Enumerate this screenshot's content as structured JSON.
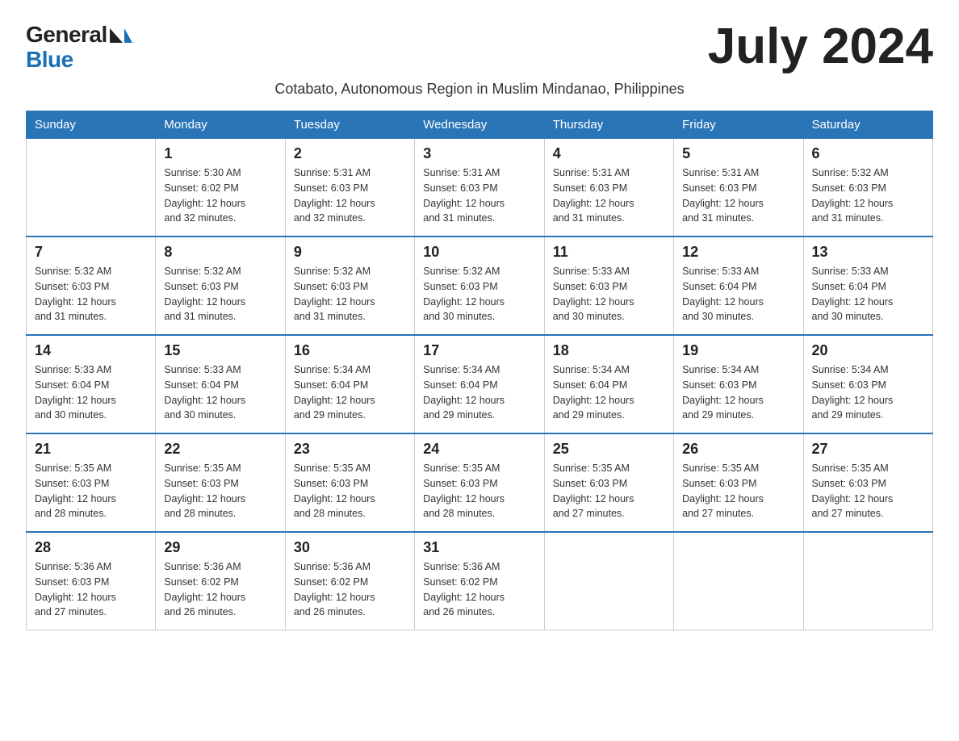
{
  "logo": {
    "general": "General",
    "blue": "Blue"
  },
  "title": "July 2024",
  "subtitle": "Cotabato, Autonomous Region in Muslim Mindanao, Philippines",
  "weekdays": [
    "Sunday",
    "Monday",
    "Tuesday",
    "Wednesday",
    "Thursday",
    "Friday",
    "Saturday"
  ],
  "weeks": [
    [
      {
        "day": "",
        "detail": ""
      },
      {
        "day": "1",
        "detail": "Sunrise: 5:30 AM\nSunset: 6:02 PM\nDaylight: 12 hours\nand 32 minutes."
      },
      {
        "day": "2",
        "detail": "Sunrise: 5:31 AM\nSunset: 6:03 PM\nDaylight: 12 hours\nand 32 minutes."
      },
      {
        "day": "3",
        "detail": "Sunrise: 5:31 AM\nSunset: 6:03 PM\nDaylight: 12 hours\nand 31 minutes."
      },
      {
        "day": "4",
        "detail": "Sunrise: 5:31 AM\nSunset: 6:03 PM\nDaylight: 12 hours\nand 31 minutes."
      },
      {
        "day": "5",
        "detail": "Sunrise: 5:31 AM\nSunset: 6:03 PM\nDaylight: 12 hours\nand 31 minutes."
      },
      {
        "day": "6",
        "detail": "Sunrise: 5:32 AM\nSunset: 6:03 PM\nDaylight: 12 hours\nand 31 minutes."
      }
    ],
    [
      {
        "day": "7",
        "detail": "Sunrise: 5:32 AM\nSunset: 6:03 PM\nDaylight: 12 hours\nand 31 minutes."
      },
      {
        "day": "8",
        "detail": "Sunrise: 5:32 AM\nSunset: 6:03 PM\nDaylight: 12 hours\nand 31 minutes."
      },
      {
        "day": "9",
        "detail": "Sunrise: 5:32 AM\nSunset: 6:03 PM\nDaylight: 12 hours\nand 31 minutes."
      },
      {
        "day": "10",
        "detail": "Sunrise: 5:32 AM\nSunset: 6:03 PM\nDaylight: 12 hours\nand 30 minutes."
      },
      {
        "day": "11",
        "detail": "Sunrise: 5:33 AM\nSunset: 6:03 PM\nDaylight: 12 hours\nand 30 minutes."
      },
      {
        "day": "12",
        "detail": "Sunrise: 5:33 AM\nSunset: 6:04 PM\nDaylight: 12 hours\nand 30 minutes."
      },
      {
        "day": "13",
        "detail": "Sunrise: 5:33 AM\nSunset: 6:04 PM\nDaylight: 12 hours\nand 30 minutes."
      }
    ],
    [
      {
        "day": "14",
        "detail": "Sunrise: 5:33 AM\nSunset: 6:04 PM\nDaylight: 12 hours\nand 30 minutes."
      },
      {
        "day": "15",
        "detail": "Sunrise: 5:33 AM\nSunset: 6:04 PM\nDaylight: 12 hours\nand 30 minutes."
      },
      {
        "day": "16",
        "detail": "Sunrise: 5:34 AM\nSunset: 6:04 PM\nDaylight: 12 hours\nand 29 minutes."
      },
      {
        "day": "17",
        "detail": "Sunrise: 5:34 AM\nSunset: 6:04 PM\nDaylight: 12 hours\nand 29 minutes."
      },
      {
        "day": "18",
        "detail": "Sunrise: 5:34 AM\nSunset: 6:04 PM\nDaylight: 12 hours\nand 29 minutes."
      },
      {
        "day": "19",
        "detail": "Sunrise: 5:34 AM\nSunset: 6:03 PM\nDaylight: 12 hours\nand 29 minutes."
      },
      {
        "day": "20",
        "detail": "Sunrise: 5:34 AM\nSunset: 6:03 PM\nDaylight: 12 hours\nand 29 minutes."
      }
    ],
    [
      {
        "day": "21",
        "detail": "Sunrise: 5:35 AM\nSunset: 6:03 PM\nDaylight: 12 hours\nand 28 minutes."
      },
      {
        "day": "22",
        "detail": "Sunrise: 5:35 AM\nSunset: 6:03 PM\nDaylight: 12 hours\nand 28 minutes."
      },
      {
        "day": "23",
        "detail": "Sunrise: 5:35 AM\nSunset: 6:03 PM\nDaylight: 12 hours\nand 28 minutes."
      },
      {
        "day": "24",
        "detail": "Sunrise: 5:35 AM\nSunset: 6:03 PM\nDaylight: 12 hours\nand 28 minutes."
      },
      {
        "day": "25",
        "detail": "Sunrise: 5:35 AM\nSunset: 6:03 PM\nDaylight: 12 hours\nand 27 minutes."
      },
      {
        "day": "26",
        "detail": "Sunrise: 5:35 AM\nSunset: 6:03 PM\nDaylight: 12 hours\nand 27 minutes."
      },
      {
        "day": "27",
        "detail": "Sunrise: 5:35 AM\nSunset: 6:03 PM\nDaylight: 12 hours\nand 27 minutes."
      }
    ],
    [
      {
        "day": "28",
        "detail": "Sunrise: 5:36 AM\nSunset: 6:03 PM\nDaylight: 12 hours\nand 27 minutes."
      },
      {
        "day": "29",
        "detail": "Sunrise: 5:36 AM\nSunset: 6:02 PM\nDaylight: 12 hours\nand 26 minutes."
      },
      {
        "day": "30",
        "detail": "Sunrise: 5:36 AM\nSunset: 6:02 PM\nDaylight: 12 hours\nand 26 minutes."
      },
      {
        "day": "31",
        "detail": "Sunrise: 5:36 AM\nSunset: 6:02 PM\nDaylight: 12 hours\nand 26 minutes."
      },
      {
        "day": "",
        "detail": ""
      },
      {
        "day": "",
        "detail": ""
      },
      {
        "day": "",
        "detail": ""
      }
    ]
  ]
}
